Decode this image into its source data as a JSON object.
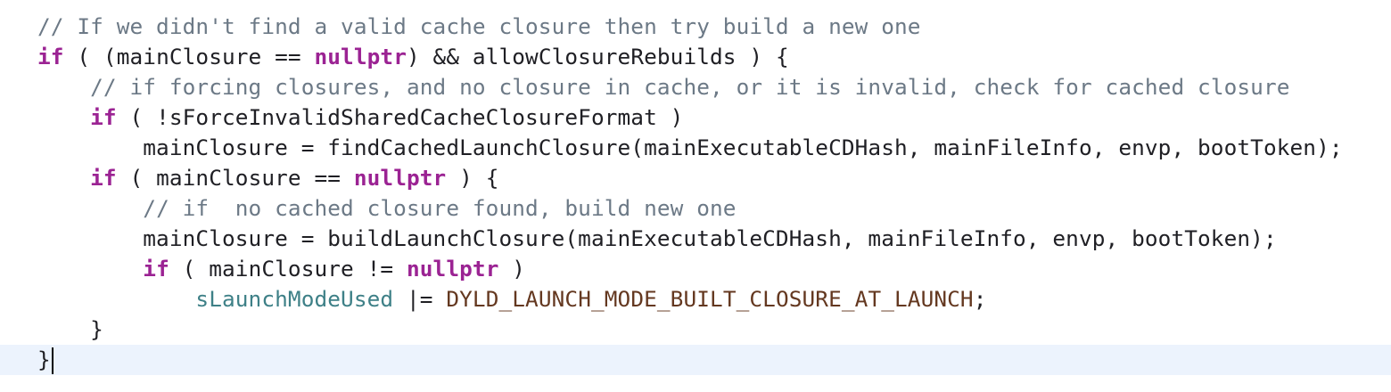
{
  "editor": {
    "current_line": 11,
    "lines": [
      [
        [
          "comment",
          "// If we didn't find a valid cache closure then try build a new one"
        ]
      ],
      [
        [
          "keyword",
          "if"
        ],
        [
          "plain",
          " ( (mainClosure == "
        ],
        [
          "keyword",
          "nullptr"
        ],
        [
          "plain",
          ") && allowClosureRebuilds ) {"
        ]
      ],
      [
        [
          "plain",
          "    "
        ],
        [
          "comment",
          "// if forcing closures, and no closure in cache, or it is invalid, check for cached closure"
        ]
      ],
      [
        [
          "plain",
          "    "
        ],
        [
          "keyword",
          "if"
        ],
        [
          "plain",
          " ( !sForceInvalidSharedCacheClosureFormat )"
        ]
      ],
      [
        [
          "plain",
          "        mainClosure = findCachedLaunchClosure(mainExecutableCDHash, mainFileInfo, envp, bootToken);"
        ]
      ],
      [
        [
          "plain",
          "    "
        ],
        [
          "keyword",
          "if"
        ],
        [
          "plain",
          " ( mainClosure == "
        ],
        [
          "keyword",
          "nullptr"
        ],
        [
          "plain",
          " ) {"
        ]
      ],
      [
        [
          "plain",
          "        "
        ],
        [
          "comment",
          "// if  no cached closure found, build new one"
        ]
      ],
      [
        [
          "plain",
          "        mainClosure = buildLaunchClosure(mainExecutableCDHash, mainFileInfo, envp, bootToken);"
        ]
      ],
      [
        [
          "plain",
          "        "
        ],
        [
          "keyword",
          "if"
        ],
        [
          "plain",
          " ( mainClosure != "
        ],
        [
          "keyword",
          "nullptr"
        ],
        [
          "plain",
          " )"
        ]
      ],
      [
        [
          "plain",
          "            "
        ],
        [
          "var",
          "sLaunchModeUsed"
        ],
        [
          "plain",
          " |= "
        ],
        [
          "macro",
          "DYLD_LAUNCH_MODE_BUILT_CLOSURE_AT_LAUNCH"
        ],
        [
          "plain",
          ";"
        ]
      ],
      [
        [
          "plain",
          "    }"
        ]
      ],
      [
        [
          "plain",
          "}"
        ]
      ]
    ]
  }
}
